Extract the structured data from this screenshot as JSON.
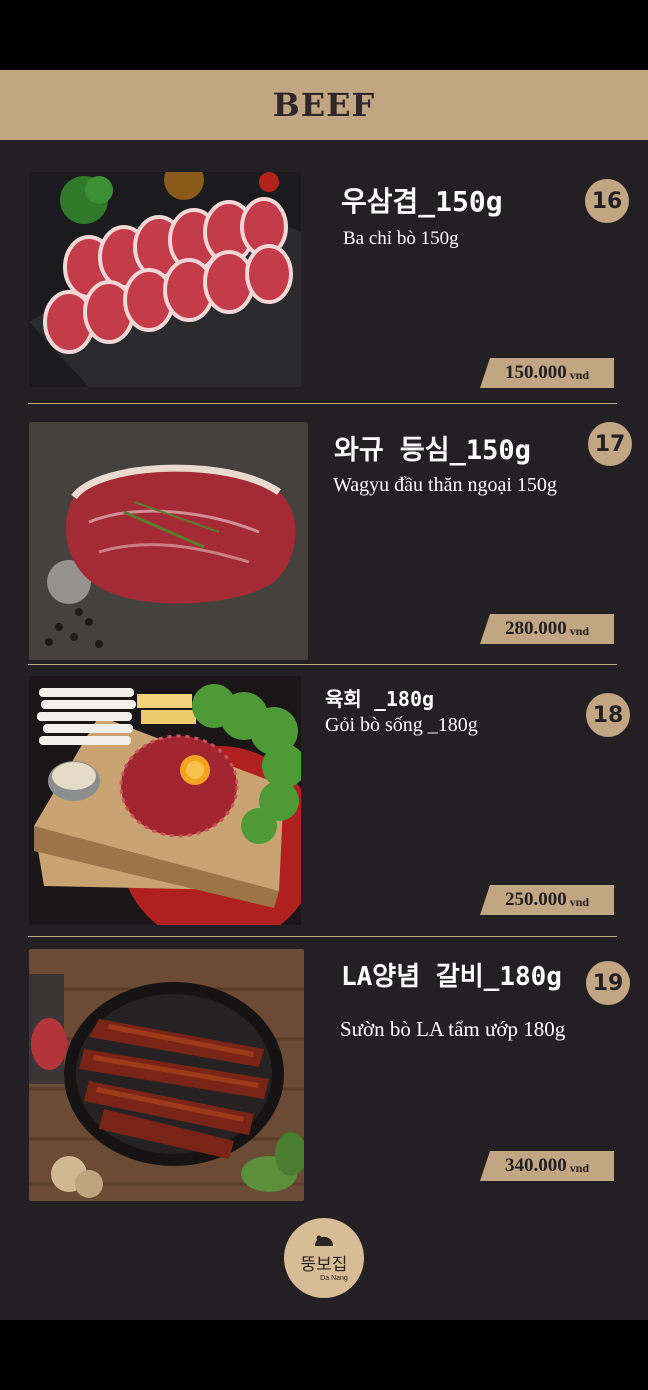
{
  "header": {
    "title": "BEEF"
  },
  "items": [
    {
      "number": "16",
      "korean_name": "우삼겹_150g",
      "vietnamese_name": "Ba chỉ bò 150g",
      "price": "150.000",
      "currency": "vnd",
      "image": "rolled-beef-belly-photo"
    },
    {
      "number": "17",
      "korean_name": "와규 등심_150g",
      "vietnamese_name": "Wagyu đầu thăn ngoại 150g",
      "price": "280.000",
      "currency": "vnd",
      "image": "wagyu-steak-photo"
    },
    {
      "number": "18",
      "korean_name": "육회 _180g",
      "vietnamese_name": "Gỏi bò sống _180g",
      "price": "250.000",
      "currency": "vnd",
      "image": "beef-tartare-photo"
    },
    {
      "number": "19",
      "korean_name": "LA양념 갈비_180g",
      "vietnamese_name": "Sườn bò LA tẩm ướp 180g",
      "price": "340.000",
      "currency": "vnd",
      "image": "marinated-short-ribs-photo"
    }
  ],
  "logo": {
    "korean": "뚱보집",
    "city": "Da Nang"
  },
  "colors": {
    "accent": "#c2a582",
    "panel": "#232024",
    "frame": "#000000"
  }
}
